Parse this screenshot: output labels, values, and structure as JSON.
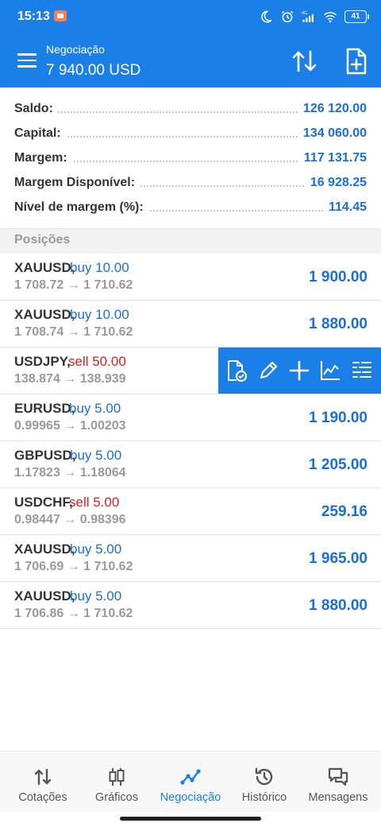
{
  "status_bar": {
    "time": "15:13",
    "network": "4G",
    "battery": "41",
    "icons": [
      "screen-record-icon",
      "moon-icon",
      "alarm-icon",
      "signal-icon",
      "wifi-icon",
      "battery-icon"
    ]
  },
  "header": {
    "subtitle": "Negociação",
    "title": "7 940.00 USD",
    "icons": [
      "menu-icon",
      "sort-icon",
      "new-order-icon"
    ]
  },
  "summary": [
    {
      "label": "Saldo:",
      "value": "126 120.00"
    },
    {
      "label": "Capital:",
      "value": "134 060.00"
    },
    {
      "label": "Margem:",
      "value": "117 131.75"
    },
    {
      "label": "Margem Disponível:",
      "value": "16 928.25"
    },
    {
      "label": "Nível de margem (%):",
      "value": "114.45"
    }
  ],
  "positions_header": "Posições",
  "positions": [
    {
      "symbol": "XAUUSD,",
      "type": "buy 10.00",
      "side": "buy",
      "prices": "1 708.72 → 1 710.62",
      "profit": "1 900.00"
    },
    {
      "symbol": "XAUUSD,",
      "type": "buy 10.00",
      "side": "buy",
      "prices": "1 708.74 → 1 710.62",
      "profit": "1 880.00"
    },
    {
      "symbol": "USDJPY,",
      "type": "sell 50.00",
      "side": "sell",
      "prices": "138.874 → 138.939",
      "profit": ""
    },
    {
      "symbol": "EURUSD,",
      "type": "buy 5.00",
      "side": "buy",
      "prices": "0.99965 → 1.00203",
      "profit": "1 190.00"
    },
    {
      "symbol": "GBPUSD,",
      "type": "buy 5.00",
      "side": "buy",
      "prices": "1.17823 → 1.18064",
      "profit": "1 205.00"
    },
    {
      "symbol": "USDCHF,",
      "type": "sell 5.00",
      "side": "sell",
      "prices": "0.98447 → 0.98396",
      "profit": "259.16"
    },
    {
      "symbol": "XAUUSD,",
      "type": "buy 5.00",
      "side": "buy",
      "prices": "1 706.69 → 1 710.62",
      "profit": "1 965.00"
    },
    {
      "symbol": "XAUUSD,",
      "type": "buy 5.00",
      "side": "buy",
      "prices": "1 706.86 → 1 710.62",
      "profit": "1 880.00"
    }
  ],
  "row_actions": [
    "close-position-icon",
    "edit-icon",
    "add-icon",
    "chart-icon",
    "details-icon"
  ],
  "bottom_nav": [
    {
      "label": "Cotações",
      "icon": "quotes-icon",
      "active": false
    },
    {
      "label": "Gráficos",
      "icon": "charts-icon",
      "active": false
    },
    {
      "label": "Negociação",
      "icon": "trade-icon",
      "active": true
    },
    {
      "label": "Histórico",
      "icon": "history-icon",
      "active": false
    },
    {
      "label": "Mensagens",
      "icon": "messages-icon",
      "active": false
    }
  ],
  "colors": {
    "accent": "#1a7fe6",
    "profit": "#1a6fd6",
    "sell": "#d32020",
    "muted": "#9a9a9a"
  }
}
